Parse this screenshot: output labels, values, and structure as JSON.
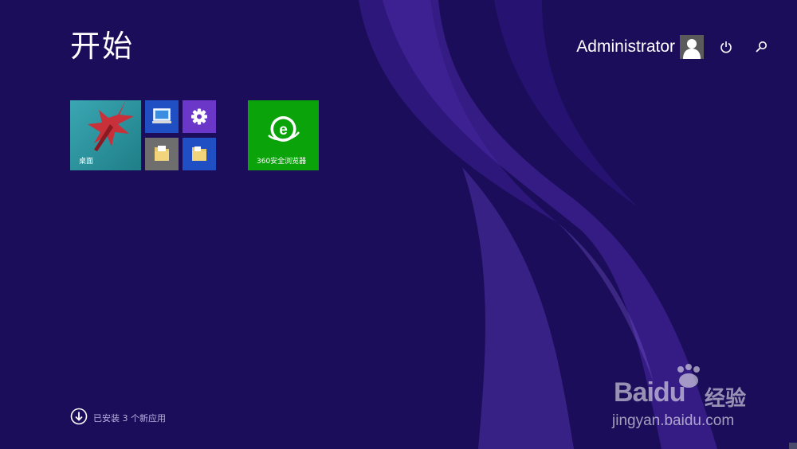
{
  "screen": {
    "title": "开始",
    "background_color": "#1b0d5a",
    "accent_swirl_color": "#4a2aa0"
  },
  "user": {
    "name": "Administrator",
    "avatar_icon": "user-silhouette-icon"
  },
  "top_actions": [
    {
      "icon": "power-icon"
    },
    {
      "icon": "search-icon"
    }
  ],
  "tiles": [
    {
      "id": "desktop",
      "label": "桌面",
      "color": "#2a8e9a",
      "icon": "desktop-wallpaper-image"
    },
    {
      "id": "this-pc",
      "label": "",
      "color": "#1f4fc2",
      "icon": "computer-icon"
    },
    {
      "id": "settings",
      "label": "",
      "color": "#6b37c8",
      "icon": "gear-icon"
    },
    {
      "id": "documents",
      "label": "",
      "color": "#6e6e6e",
      "icon": "document-folder-icon"
    },
    {
      "id": "file-explorer",
      "label": "",
      "color": "#1f4fc2",
      "icon": "folder-icon"
    },
    {
      "id": "360-browser",
      "label": "360安全浏览器",
      "color": "#0aa30a",
      "icon": "360-browser-e-icon"
    }
  ],
  "footer": {
    "installed_text": "已安装 3 个新应用",
    "icon": "download-arrow-icon"
  },
  "watermark": {
    "logo": "Bai",
    "logo_suffix": "du",
    "text_cn": "经验",
    "url": "jingyan.baidu.com"
  }
}
